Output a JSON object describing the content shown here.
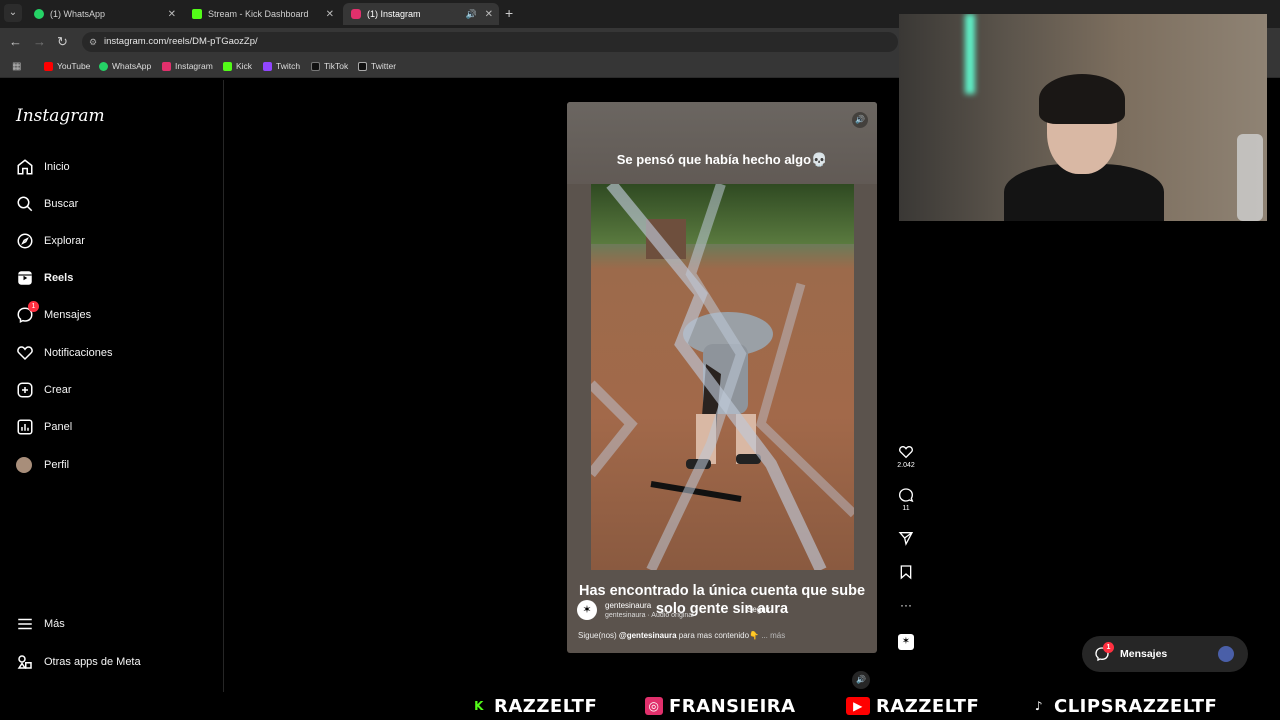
{
  "browser": {
    "tabs": [
      {
        "label": "(1) WhatsApp",
        "color": "#25d366"
      },
      {
        "label": "Stream - Kick Dashboard",
        "color": "#53fc18"
      },
      {
        "label": "(1) Instagram",
        "color": "#e1306c"
      }
    ],
    "url": "instagram.com/reels/DM-pTGaozZp/",
    "bookmarks": [
      "YouTube",
      "WhatsApp",
      "Instagram",
      "Kick",
      "Twitch",
      "TikTok",
      "Twitter"
    ]
  },
  "sidebar": {
    "logo": "Instagram",
    "items": [
      {
        "label": "Inicio",
        "icon": "home-icon"
      },
      {
        "label": "Buscar",
        "icon": "search-icon"
      },
      {
        "label": "Explorar",
        "icon": "compass-icon"
      },
      {
        "label": "Reels",
        "icon": "reels-icon"
      },
      {
        "label": "Mensajes",
        "icon": "messenger-icon",
        "badge": "1"
      },
      {
        "label": "Notificaciones",
        "icon": "heart-icon"
      },
      {
        "label": "Crear",
        "icon": "plus-icon"
      },
      {
        "label": "Panel",
        "icon": "chart-icon"
      },
      {
        "label": "Perfil",
        "icon": "avatar"
      }
    ],
    "more": "Más",
    "meta_apps": "Otras apps de Meta"
  },
  "reel": {
    "caption_top": "Se pensó que había hecho algo💀",
    "caption_bottom": "Has encontrado la única cuenta que sube solo gente sin aura",
    "username": "gentesinaura",
    "audio": "gentesinaura · Audio original",
    "follow": "Seguir",
    "description_prefix": "Sigue(nos)",
    "description_mention": "@gentesinaura",
    "description_suffix": "para mas contenido👇",
    "description_more": "... más"
  },
  "actions": {
    "likes": "2.042",
    "comments": "11"
  },
  "messages_pill": {
    "label": "Mensajes",
    "badge": "1"
  },
  "banner": [
    {
      "label": "RAZZELTF",
      "icon": "kick-icon",
      "color": "#53fc18"
    },
    {
      "label": "FRANSIEIRA",
      "icon": "instagram-icon",
      "color": "#e1306c"
    },
    {
      "label": "RAZZELTF",
      "icon": "youtube-icon",
      "color": "#ff0000"
    },
    {
      "label": "CLIPSRAZZELTF",
      "icon": "tiktok-icon",
      "color": "#ffffff"
    }
  ]
}
